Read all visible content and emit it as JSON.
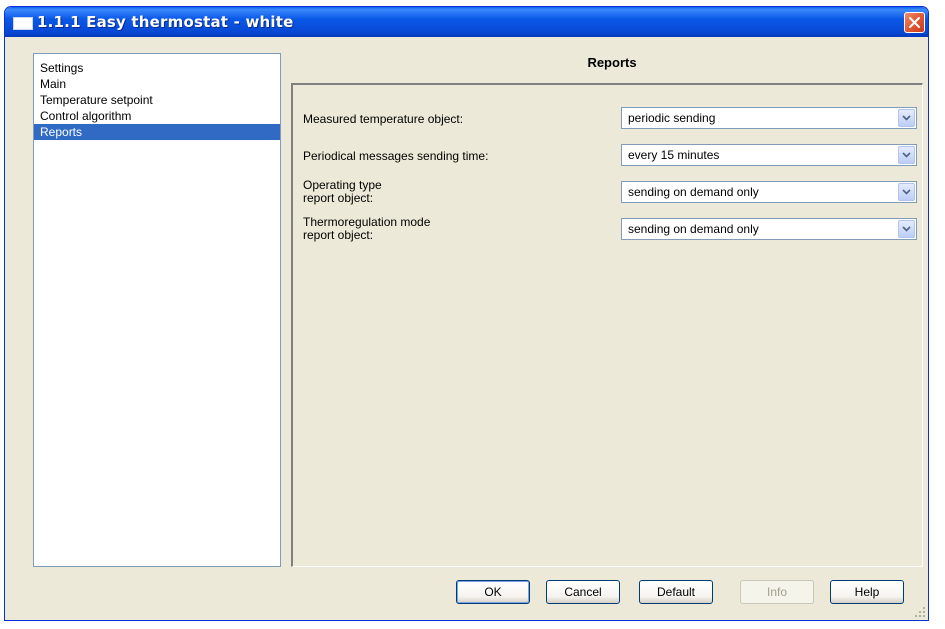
{
  "window": {
    "title": "1.1.1 Easy thermostat - white"
  },
  "tree": {
    "items": [
      {
        "label": "Settings"
      },
      {
        "label": "Main"
      },
      {
        "label": "Temperature setpoint"
      },
      {
        "label": "Control algorithm"
      },
      {
        "label": "Reports",
        "selected": true
      }
    ]
  },
  "panel": {
    "title": "Reports",
    "params": [
      {
        "label": "Measured temperature object:",
        "value": "periodic sending"
      },
      {
        "label": "Periodical messages sending time:",
        "value": "every 15 minutes"
      },
      {
        "label_line1": "Operating type",
        "label_line2": "report object:",
        "value": "sending on demand only"
      },
      {
        "label_line1": "Thermoregulation mode",
        "label_line2": "report object:",
        "value": "sending on demand only"
      }
    ]
  },
  "buttons": {
    "ok": "OK",
    "cancel": "Cancel",
    "default": "Default",
    "info": "Info",
    "help": "Help"
  },
  "colors": {
    "selection": "#316ac5",
    "titlebar": "#0a58e7",
    "dialog_bg": "#ece9d8"
  }
}
